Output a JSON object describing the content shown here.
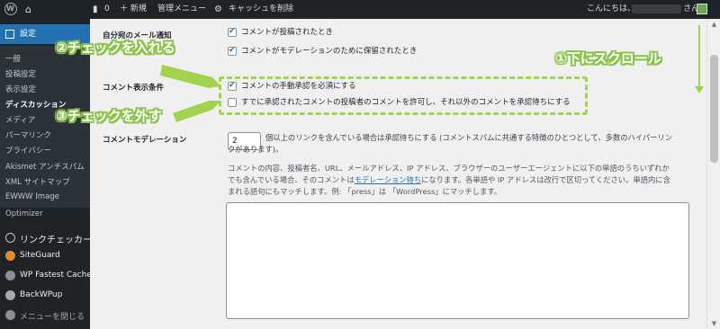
{
  "adminbar": {
    "comments_count": "0",
    "new_label": "＋ 新規",
    "manager_menu": "管理メニュー",
    "cache_clear": "キャッシュを削除",
    "greeting": "こんにちは、",
    "greeting_suffix": "さん"
  },
  "sidebar": {
    "current_menu": "設定",
    "submenu": [
      "一般",
      "投稿設定",
      "表示設定",
      "ディスカッション",
      "メディア",
      "パーマリンク",
      "プライバシー",
      "Akismet アンチスパム",
      "XML サイトマップ",
      "EWWW Image",
      "Optimizer"
    ],
    "plugins": [
      "リンクチェッカー",
      "SiteGuard",
      "WP Fastest Cache",
      "BackWPup",
      "メニューを閉じる"
    ]
  },
  "settings": {
    "email_notify_label": "自分宛のメール通知",
    "email_opt1": "コメントが投稿されたとき",
    "email_opt2": "コメントがモデレーションのために保留されたとき",
    "display_cond_label": "コメント表示条件",
    "display_opt1": "コメントの手動承認を必須にする",
    "display_opt2": "すでに承認されたコメントの投稿者のコメントを許可し、それ以外のコメントを承認待ちにする",
    "moderation_label": "コメントモデレーション",
    "link_count_value": "2",
    "link_count_text_1": "個以上のリンクを含んでいる場合は承認待ちにする (コメントスパムに共通する特徴のひとつとして、多数のハイパーリン",
    "link_count_text_2": "クがあります)。",
    "desc_line1": "コメントの内容、投稿者名、URL、メールアドレス、IP アドレス、ブラウザーのユーザーエージェントに以下の単語のうちいずれか",
    "desc_line2a": "でも含んでいる場合、そのコメントは",
    "desc_link": "モデレーション待ち",
    "desc_line2b": "になります。各単語や IP アドレスは改行で区切ってください。単語内に含",
    "desc_line3": "まれる語句にもマッチします。例: 「press」は 「WordPress」にマッチします。"
  },
  "annotations": {
    "step1": "①下にスクロール",
    "step2": "②チェックを入れる",
    "step3": "③チェックを外す",
    "accent_color": "#8bc34a"
  }
}
